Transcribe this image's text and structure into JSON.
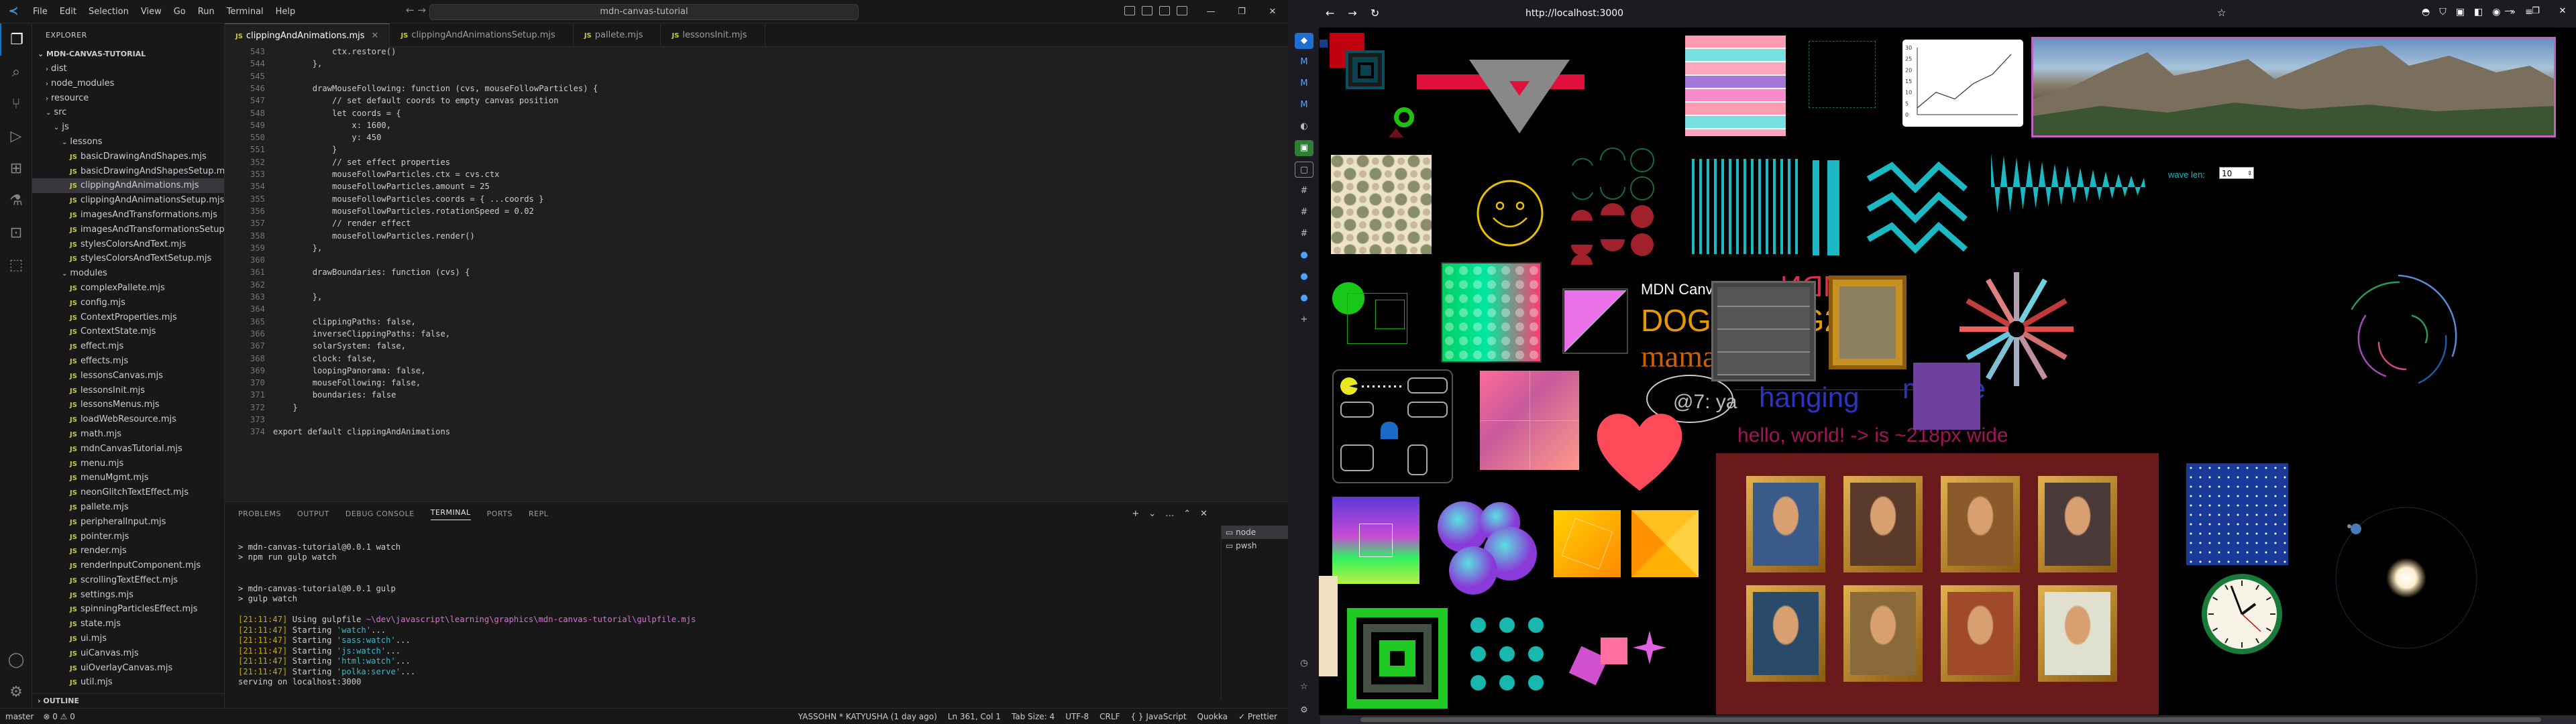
{
  "vscode": {
    "menu": [
      "File",
      "Edit",
      "Selection",
      "View",
      "Go",
      "Run",
      "Terminal",
      "Help"
    ],
    "command_center": "mdn-canvas-tutorial",
    "explorer_title": "EXPLORER",
    "root_folder": "MDN-CANVAS-TUTORIAL",
    "tree": [
      {
        "label": "dist",
        "kind": "folder"
      },
      {
        "label": "node_modules",
        "kind": "folder"
      },
      {
        "label": "resource",
        "kind": "folder"
      },
      {
        "label": "src",
        "kind": "folder-open"
      },
      {
        "label": "js",
        "kind": "folder-open"
      },
      {
        "label": "lessons",
        "kind": "folder-open"
      },
      {
        "label": "basicDrawingAndShapes.mjs",
        "kind": "file"
      },
      {
        "label": "basicDrawingAndShapesSetup.mjs",
        "kind": "file"
      },
      {
        "label": "clippingAndAnimations.mjs",
        "kind": "file",
        "selected": true
      },
      {
        "label": "clippingAndAnimationsSetup.mjs",
        "kind": "file"
      },
      {
        "label": "imagesAndTransformations.mjs",
        "kind": "file"
      },
      {
        "label": "imagesAndTransformationsSetup.mjs",
        "kind": "file"
      },
      {
        "label": "stylesColorsAndText.mjs",
        "kind": "file"
      },
      {
        "label": "stylesColorsAndTextSetup.mjs",
        "kind": "file"
      },
      {
        "label": "modules",
        "kind": "folder-open"
      },
      {
        "label": "complexPallete.mjs",
        "kind": "file"
      },
      {
        "label": "config.mjs",
        "kind": "file"
      },
      {
        "label": "ContextProperties.mjs",
        "kind": "file"
      },
      {
        "label": "ContextState.mjs",
        "kind": "file"
      },
      {
        "label": "effect.mjs",
        "kind": "file"
      },
      {
        "label": "effects.mjs",
        "kind": "file"
      },
      {
        "label": "lessonsCanvas.mjs",
        "kind": "file"
      },
      {
        "label": "lessonsInit.mjs",
        "kind": "file"
      },
      {
        "label": "lessonsMenus.mjs",
        "kind": "file"
      },
      {
        "label": "loadWebResource.mjs",
        "kind": "file"
      },
      {
        "label": "math.mjs",
        "kind": "file"
      },
      {
        "label": "mdnCanvasTutorial.mjs",
        "kind": "file"
      },
      {
        "label": "menu.mjs",
        "kind": "file"
      },
      {
        "label": "menuMgmt.mjs",
        "kind": "file"
      },
      {
        "label": "neonGlitchTextEffect.mjs",
        "kind": "file"
      },
      {
        "label": "pallete.mjs",
        "kind": "file"
      },
      {
        "label": "peripheralInput.mjs",
        "kind": "file"
      },
      {
        "label": "pointer.mjs",
        "kind": "file"
      },
      {
        "label": "render.mjs",
        "kind": "file"
      },
      {
        "label": "renderInputComponent.mjs",
        "kind": "file"
      },
      {
        "label": "scrollingTextEffect.mjs",
        "kind": "file"
      },
      {
        "label": "settings.mjs",
        "kind": "file"
      },
      {
        "label": "spinningParticlesEffect.mjs",
        "kind": "file"
      },
      {
        "label": "state.mjs",
        "kind": "file"
      },
      {
        "label": "ui.mjs",
        "kind": "file"
      },
      {
        "label": "uiCanvas.mjs",
        "kind": "file"
      },
      {
        "label": "uiOverlayCanvas.mjs",
        "kind": "file"
      },
      {
        "label": "util.mjs",
        "kind": "file"
      }
    ],
    "outline_label": "OUTLINE",
    "tabs": [
      {
        "label": "clippingAndAnimations.mjs",
        "active": true
      },
      {
        "label": "clippingAndAnimationsSetup.mjs",
        "active": false
      },
      {
        "label": "pallete.mjs",
        "active": false
      },
      {
        "label": "lessonsInit.mjs",
        "active": false
      }
    ],
    "code_lines": [
      {
        "n": "543",
        "t": "            ctx.restore()"
      },
      {
        "n": "544",
        "t": "        },"
      },
      {
        "n": "545",
        "t": ""
      },
      {
        "n": "546",
        "t": "        drawMouseFollowing: function (cvs, mouseFollowParticles) {"
      },
      {
        "n": "547",
        "t": "            // set default coords to empty canvas position"
      },
      {
        "n": "548",
        "t": "            let coords = {"
      },
      {
        "n": "549",
        "t": "                x: 1600,"
      },
      {
        "n": "550",
        "t": "                y: 450"
      },
      {
        "n": "551",
        "t": "            }"
      },
      {
        "n": "352",
        "t": "            // set effect properties"
      },
      {
        "n": "353",
        "t": "            mouseFollowParticles.ctx = cvs.ctx"
      },
      {
        "n": "354",
        "t": "            mouseFollowParticles.amount = 25"
      },
      {
        "n": "355",
        "t": "            mouseFollowParticles.coords = { ...coords }"
      },
      {
        "n": "356",
        "t": "            mouseFollowParticles.rotationSpeed = 0.02"
      },
      {
        "n": "357",
        "t": "            // render effect"
      },
      {
        "n": "358",
        "t": "            mouseFollowParticles.render()"
      },
      {
        "n": "359",
        "t": "        },"
      },
      {
        "n": "360",
        "t": ""
      },
      {
        "n": "361",
        "t": "        drawBoundaries: function (cvs) {"
      },
      {
        "n": "362",
        "t": ""
      },
      {
        "n": "363",
        "t": "        },"
      },
      {
        "n": "364",
        "t": ""
      },
      {
        "n": "365",
        "t": "        clippingPaths: false,"
      },
      {
        "n": "366",
        "t": "        inverseClippingPaths: false,"
      },
      {
        "n": "367",
        "t": "        solarSystem: false,"
      },
      {
        "n": "368",
        "t": "        clock: false,"
      },
      {
        "n": "369",
        "t": "        loopingPanorama: false,"
      },
      {
        "n": "370",
        "t": "        mouseFollowing: false,"
      },
      {
        "n": "371",
        "t": "        boundaries: false"
      },
      {
        "n": "372",
        "t": "    }"
      },
      {
        "n": "373",
        "t": ""
      },
      {
        "n": "374",
        "t": "export default clippingAndAnimations"
      }
    ],
    "panel_tabs": [
      "PROBLEMS",
      "OUTPUT",
      "DEBUG CONSOLE",
      "TERMINAL",
      "PORTS",
      "REPL"
    ],
    "terminal_lines": [
      "",
      "> mdn-canvas-tutorial@0.0.1 watch",
      "> npm run gulp watch",
      "",
      "",
      "> mdn-canvas-tutorial@0.0.1 gulp",
      "> gulp watch",
      "",
      "[21:11:47] Using gulpfile ~\\dev\\javascript\\learning\\graphics\\mdn-canvas-tutorial\\gulpfile.mjs",
      "[21:11:47] Starting 'watch'...",
      "[21:11:47] Starting 'sass:watch'...",
      "[21:11:47] Starting 'js:watch'...",
      "[21:11:47] Starting 'html:watch'...",
      "[21:11:47] Starting 'polka:serve'...",
      "serving on localhost:3000"
    ],
    "terminal_list": [
      "node",
      "pwsh"
    ],
    "status_left": [
      "master",
      "⊗ 0 ⚠ 0"
    ],
    "status_right": [
      "YASSOHN * KATYUSHA (1 day ago)",
      "Ln 361, Col 1",
      "Tab Size: 4",
      "UTF-8",
      "CRLF",
      "{ } JavaScript",
      "Quokka",
      "✓ Prettier"
    ]
  },
  "firefox": {
    "url": "http://localhost:3000",
    "canvas": {
      "title_text": "MDN Canvas Tutorial",
      "dog_text": "DOG 1, DOG2",
      "mama_text": "mama mia!",
      "mirror_text": "MDN",
      "at7_text": "@7: ya",
      "hanging_text": "hanging",
      "middle_text": "middle",
      "hello_text": "hello, world! -> is ~218px wide",
      "wave_label": "wave len:",
      "wave_value": "10"
    },
    "line_chart": {
      "y_ticks": [
        "30",
        "25",
        "20",
        "15",
        "10",
        "5",
        "0"
      ],
      "points": [
        [
          0,
          3
        ],
        [
          1,
          10
        ],
        [
          2,
          7
        ],
        [
          3,
          14
        ],
        [
          4,
          18
        ],
        [
          5,
          27
        ]
      ]
    },
    "clock_time": "1:48"
  }
}
